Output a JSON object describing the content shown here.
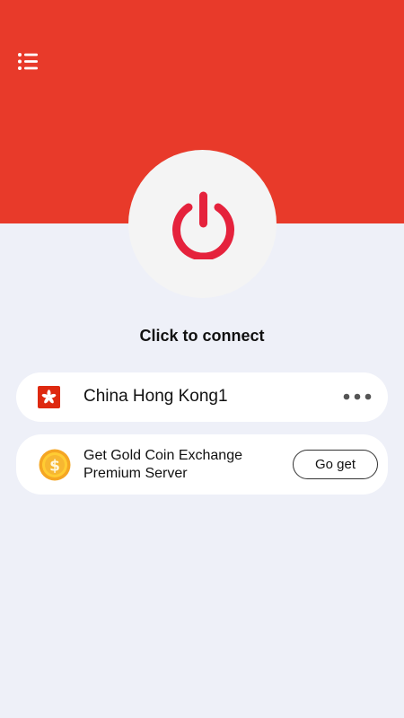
{
  "header": {
    "background_color": "#e83a2a",
    "menu_icon": "list-menu-icon"
  },
  "connect": {
    "icon": "power-icon",
    "icon_color": "#e5223c",
    "status_text": "Click to connect"
  },
  "server": {
    "flag_icon": "hong-kong-flag-icon",
    "name": "China Hong Kong1",
    "more_icon": "more-horizontal-icon"
  },
  "promo": {
    "coin_icon": "gold-coin-icon",
    "line1": "Get Gold Coin Exchange",
    "line2": "Premium Server",
    "button_label": "Go get"
  }
}
